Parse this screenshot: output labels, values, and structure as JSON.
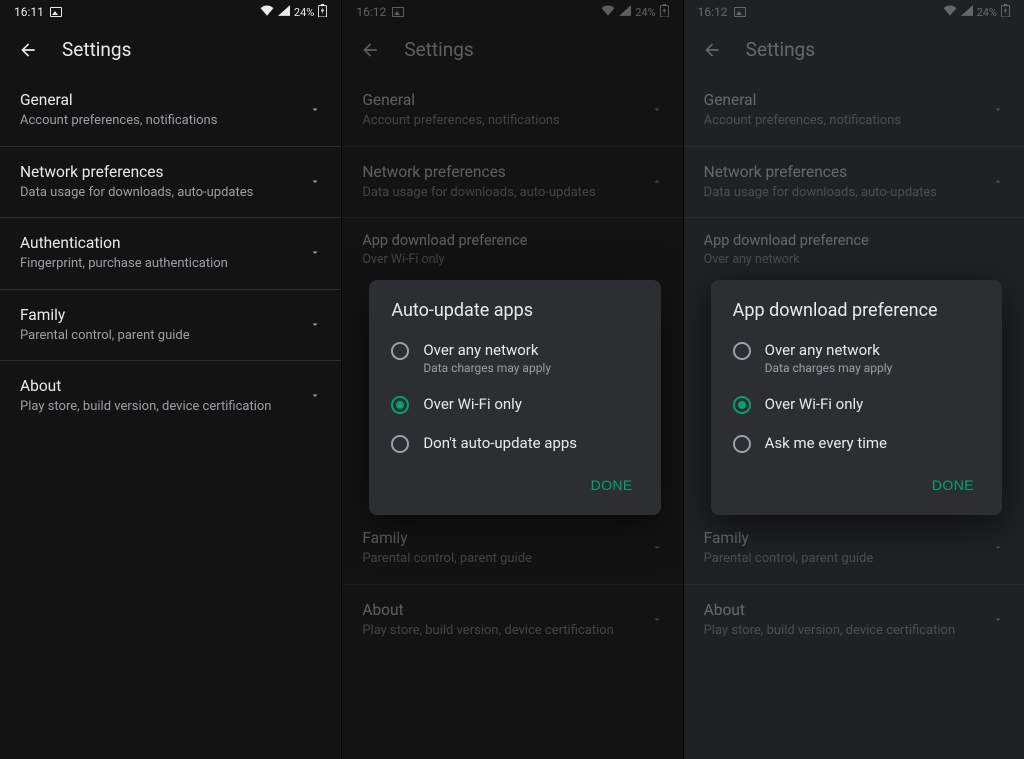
{
  "status": {
    "battery": "24%",
    "wifi_icon": "wifi-icon",
    "signal_icon": "signal-icon",
    "battery_icon": "battery-charging-icon",
    "picture_icon": "picture-icon"
  },
  "header_title": "Settings",
  "screens": [
    {
      "time": "16:11"
    },
    {
      "time": "16:12"
    },
    {
      "time": "16:12"
    }
  ],
  "items": {
    "general": {
      "title": "General",
      "sub": "Account preferences, notifications"
    },
    "network": {
      "title": "Network preferences",
      "sub": "Data usage for downloads, auto-updates"
    },
    "auth": {
      "title": "Authentication",
      "sub": "Fingerprint, purchase authentication"
    },
    "family": {
      "title": "Family",
      "sub": "Parental control, parent guide"
    },
    "about": {
      "title": "About",
      "sub": "Play store, build version, device certification"
    },
    "app_download_pref": {
      "title": "App download preference",
      "sub_wifi": "Over Wi-Fi only",
      "sub_any": "Over any network"
    }
  },
  "dialogs": {
    "auto_update": {
      "title": "Auto-update apps",
      "options": [
        {
          "label": "Over any network",
          "sub": "Data charges may apply",
          "selected": false
        },
        {
          "label": "Over Wi-Fi only",
          "sub": "",
          "selected": true
        },
        {
          "label": "Don't auto-update apps",
          "sub": "",
          "selected": false
        }
      ],
      "done": "DONE"
    },
    "app_download": {
      "title": "App download preference",
      "options": [
        {
          "label": "Over any network",
          "sub": "Data charges may apply",
          "selected": false
        },
        {
          "label": "Over Wi-Fi only",
          "sub": "",
          "selected": true
        },
        {
          "label": "Ask me every time",
          "sub": "",
          "selected": false
        }
      ],
      "done": "DONE"
    }
  }
}
